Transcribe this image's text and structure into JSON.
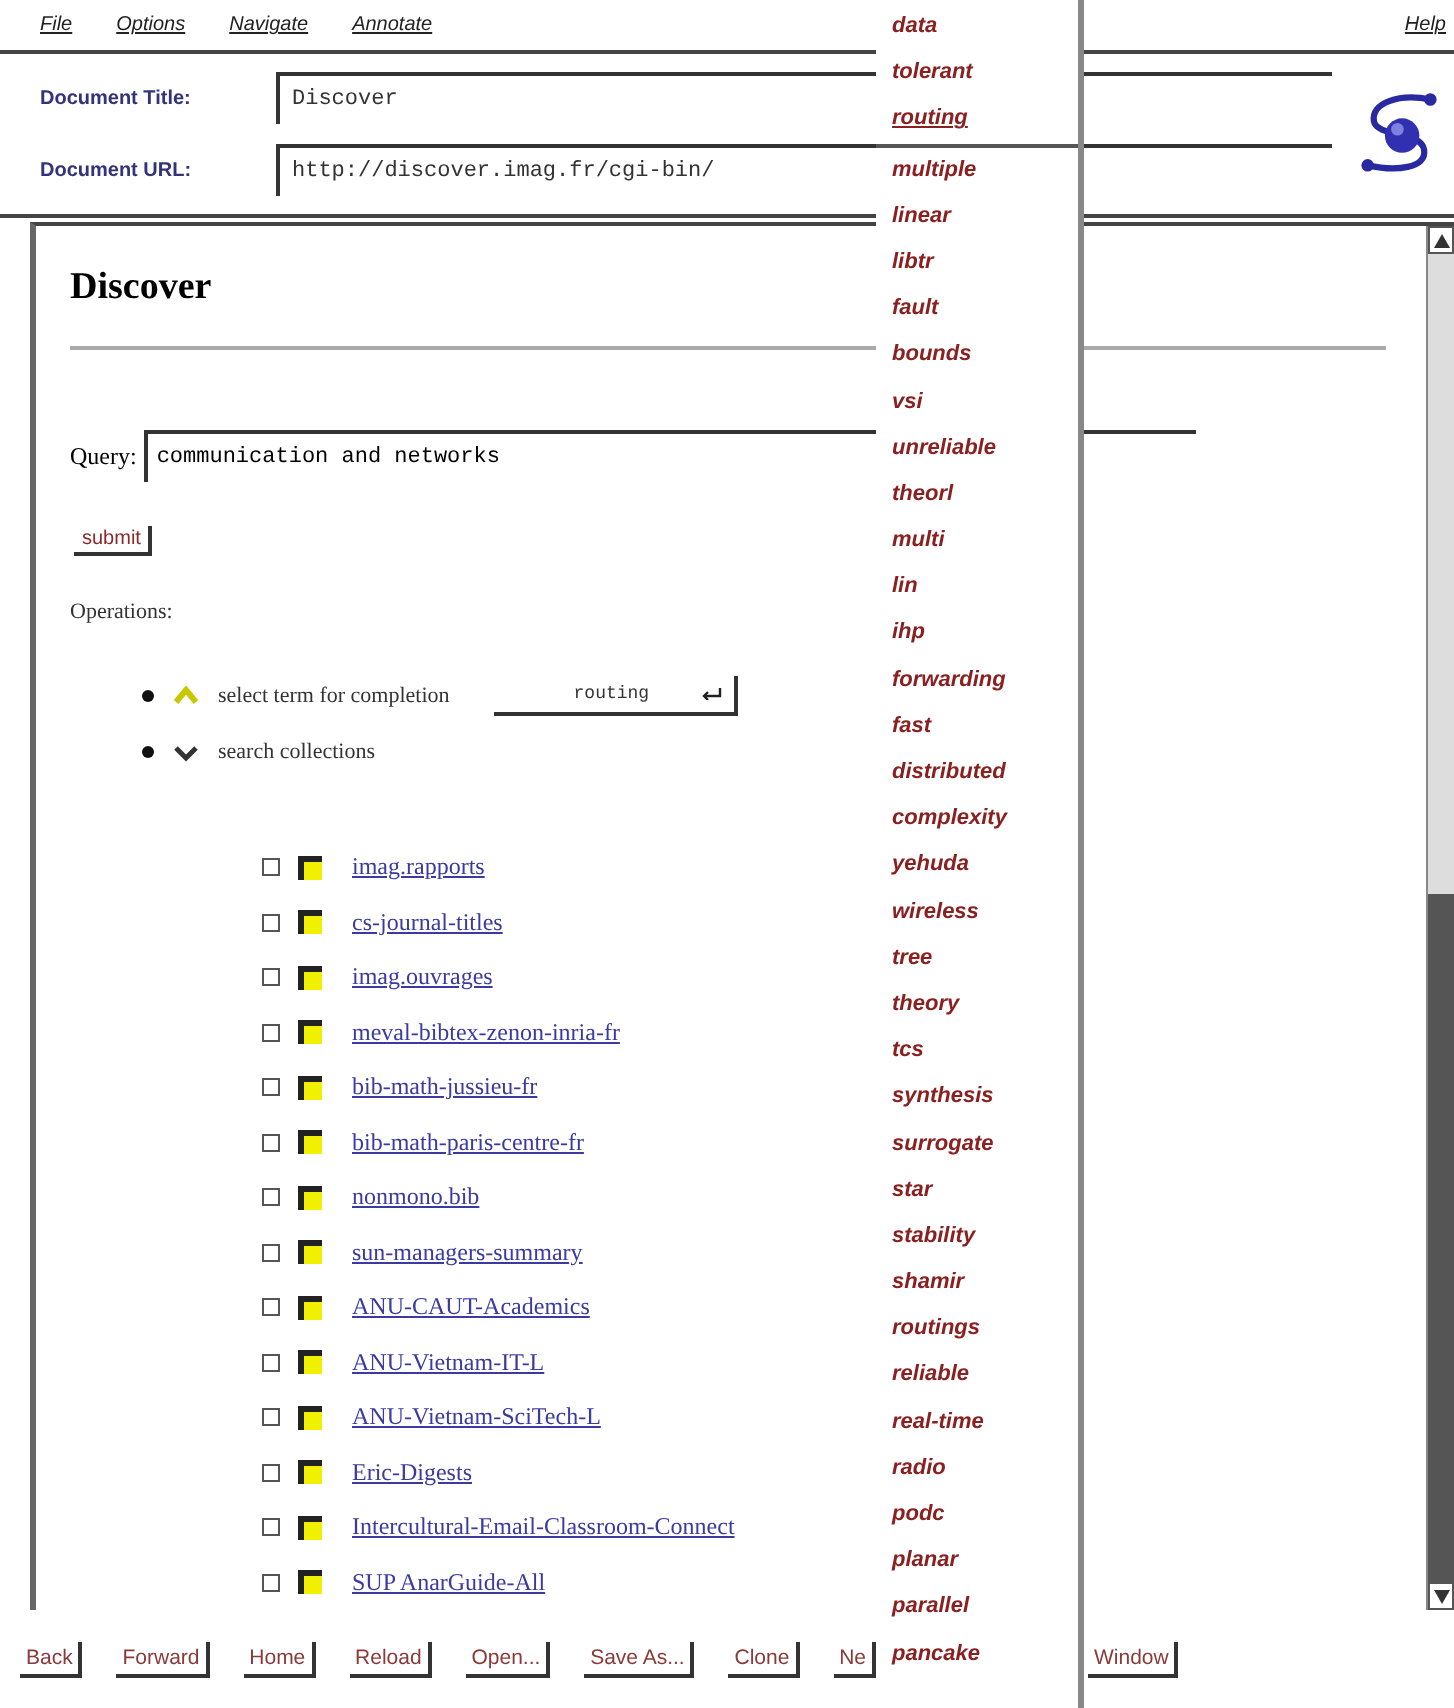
{
  "menu": [
    "File",
    "Options",
    "Navigate",
    "Annotate"
  ],
  "help_menu": "Help",
  "document_title": {
    "label": "Document Title:",
    "value": "Discover"
  },
  "document_url": {
    "label": "Document URL:",
    "value": "http://discover.imag.fr/cgi-bin/"
  },
  "page": {
    "heading": "Discover",
    "query": {
      "label": "Query:",
      "value": "communication and networks"
    },
    "submit": "submit",
    "operations_label": "Operations:",
    "operations": [
      {
        "label": "select term for completion",
        "kind": "up",
        "dropdown": "routing"
      },
      {
        "label": "search collections",
        "kind": "down"
      }
    ],
    "collections": [
      {
        "name": "imag.rapports",
        "checked": false
      },
      {
        "name": "cs-journal-titles",
        "checked": false
      },
      {
        "name": "imag.ouvrages",
        "checked": false
      },
      {
        "name": "meval-bibtex-zenon-inria-fr",
        "checked": false
      },
      {
        "name": "bib-math-jussieu-fr",
        "checked": false
      },
      {
        "name": "bib-math-paris-centre-fr",
        "checked": false
      },
      {
        "name": "nonmono.bib",
        "checked": false
      },
      {
        "name": "sun-managers-summary",
        "checked": false
      },
      {
        "name": "ANU-CAUT-Academics",
        "checked": false
      },
      {
        "name": "ANU-Vietnam-IT-L",
        "checked": false
      },
      {
        "name": "ANU-Vietnam-SciTech-L",
        "checked": false
      },
      {
        "name": "Eric-Digests",
        "checked": false
      },
      {
        "name": "Intercultural-Email-Classroom-Connect",
        "checked": false
      },
      {
        "name": "SUP AnarGuide-All",
        "checked": false
      }
    ]
  },
  "bottom_buttons": [
    "Back",
    "Forward",
    "Home",
    "Reload",
    "Open...",
    "Save As...",
    "Clone",
    "Ne"
  ],
  "bottom_buttons_right": [
    "Window"
  ],
  "term_list": [
    {
      "term": "data",
      "selected": false
    },
    {
      "term": "tolerant",
      "selected": false
    },
    {
      "term": "routing",
      "selected": true
    },
    {
      "term": "multiple",
      "selected": false
    },
    {
      "term": "linear",
      "selected": false
    },
    {
      "term": "libtr",
      "selected": false
    },
    {
      "term": "fault",
      "selected": false
    },
    {
      "term": "bounds",
      "selected": false
    },
    {
      "term": "vsi",
      "selected": false
    },
    {
      "term": "unreliable",
      "selected": false
    },
    {
      "term": "theorl",
      "selected": false
    },
    {
      "term": "multi",
      "selected": false
    },
    {
      "term": "lin",
      "selected": false
    },
    {
      "term": "ihp",
      "selected": false
    },
    {
      "term": "forwarding",
      "selected": false
    },
    {
      "term": "fast",
      "selected": false
    },
    {
      "term": "distributed",
      "selected": false
    },
    {
      "term": "complexity",
      "selected": false
    },
    {
      "term": "yehuda",
      "selected": false
    },
    {
      "term": "wireless",
      "selected": false
    },
    {
      "term": "tree",
      "selected": false
    },
    {
      "term": "theory",
      "selected": false
    },
    {
      "term": "tcs",
      "selected": false
    },
    {
      "term": "synthesis",
      "selected": false
    },
    {
      "term": "surrogate",
      "selected": false
    },
    {
      "term": "star",
      "selected": false
    },
    {
      "term": "stability",
      "selected": false
    },
    {
      "term": "shamir",
      "selected": false
    },
    {
      "term": "routings",
      "selected": false
    },
    {
      "term": "reliable",
      "selected": false
    },
    {
      "term": "real-time",
      "selected": false
    },
    {
      "term": "radio",
      "selected": false
    },
    {
      "term": "podc",
      "selected": false
    },
    {
      "term": "planar",
      "selected": false
    },
    {
      "term": "parallel",
      "selected": false
    },
    {
      "term": "pancake",
      "selected": false
    }
  ]
}
